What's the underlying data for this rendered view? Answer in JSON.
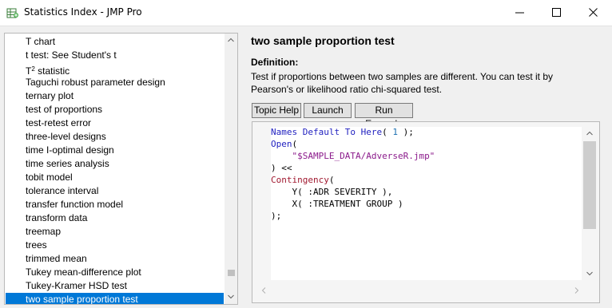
{
  "window": {
    "title": "Statistics Index - JMP Pro",
    "icons": [
      "jmp-app-icon",
      "minimize-icon",
      "maximize-icon",
      "close-icon"
    ]
  },
  "index_list": {
    "items": [
      {
        "label": "T chart"
      },
      {
        "label": "t test: See Student's t"
      },
      {
        "label": "T",
        "sup": "2",
        "label_after": " statistic"
      },
      {
        "label": "Taguchi robust parameter design"
      },
      {
        "label": "ternary plot"
      },
      {
        "label": "test of proportions"
      },
      {
        "label": "test-retest error"
      },
      {
        "label": "three-level designs"
      },
      {
        "label": "time I-optimal design"
      },
      {
        "label": "time series analysis"
      },
      {
        "label": "tobit model"
      },
      {
        "label": "tolerance interval"
      },
      {
        "label": "transfer function model"
      },
      {
        "label": "transform data"
      },
      {
        "label": "treemap"
      },
      {
        "label": "trees"
      },
      {
        "label": "trimmed mean"
      },
      {
        "label": "Tukey mean-difference plot"
      },
      {
        "label": "Tukey-Kramer HSD test"
      },
      {
        "label": "two sample proportion test",
        "selected": true
      }
    ]
  },
  "topic": {
    "title": "two sample proportion test",
    "definition_label": "Definition:",
    "definition_text": "Test if proportions between two samples are different. You can test it by Pearson's or likelihood ratio chi-squared test."
  },
  "buttons": {
    "topic_help": "Topic Help",
    "launch": "Launch",
    "run_example": "Run Example"
  },
  "script": {
    "lines": [
      [
        {
          "t": "Names Default To Here",
          "c": "kw"
        },
        {
          "t": "( ",
          "c": "pl"
        },
        {
          "t": "1",
          "c": "num"
        },
        {
          "t": " );",
          "c": "pl"
        }
      ],
      [
        {
          "t": "Open",
          "c": "kw"
        },
        {
          "t": "(",
          "c": "pl"
        }
      ],
      [
        {
          "t": "    ",
          "c": "pl"
        },
        {
          "t": "\"$SAMPLE_DATA/AdverseR.jmp\"",
          "c": "str"
        }
      ],
      [
        {
          "t": ") <<",
          "c": "pl"
        }
      ],
      [
        {
          "t": "Contingency",
          "c": "fn"
        },
        {
          "t": "(",
          "c": "pl"
        }
      ],
      [
        {
          "t": "    Y( :ADR SEVERITY ),",
          "c": "pl"
        }
      ],
      [
        {
          "t": "    X( :TREATMENT GROUP )",
          "c": "pl"
        }
      ],
      [
        {
          "t": ");",
          "c": "pl"
        }
      ]
    ]
  },
  "colors": {
    "selection": "#0078d7",
    "keyword": "#1f1fbf",
    "function": "#a0182f",
    "string": "#8b1a8b",
    "number": "#1a6eb0"
  }
}
